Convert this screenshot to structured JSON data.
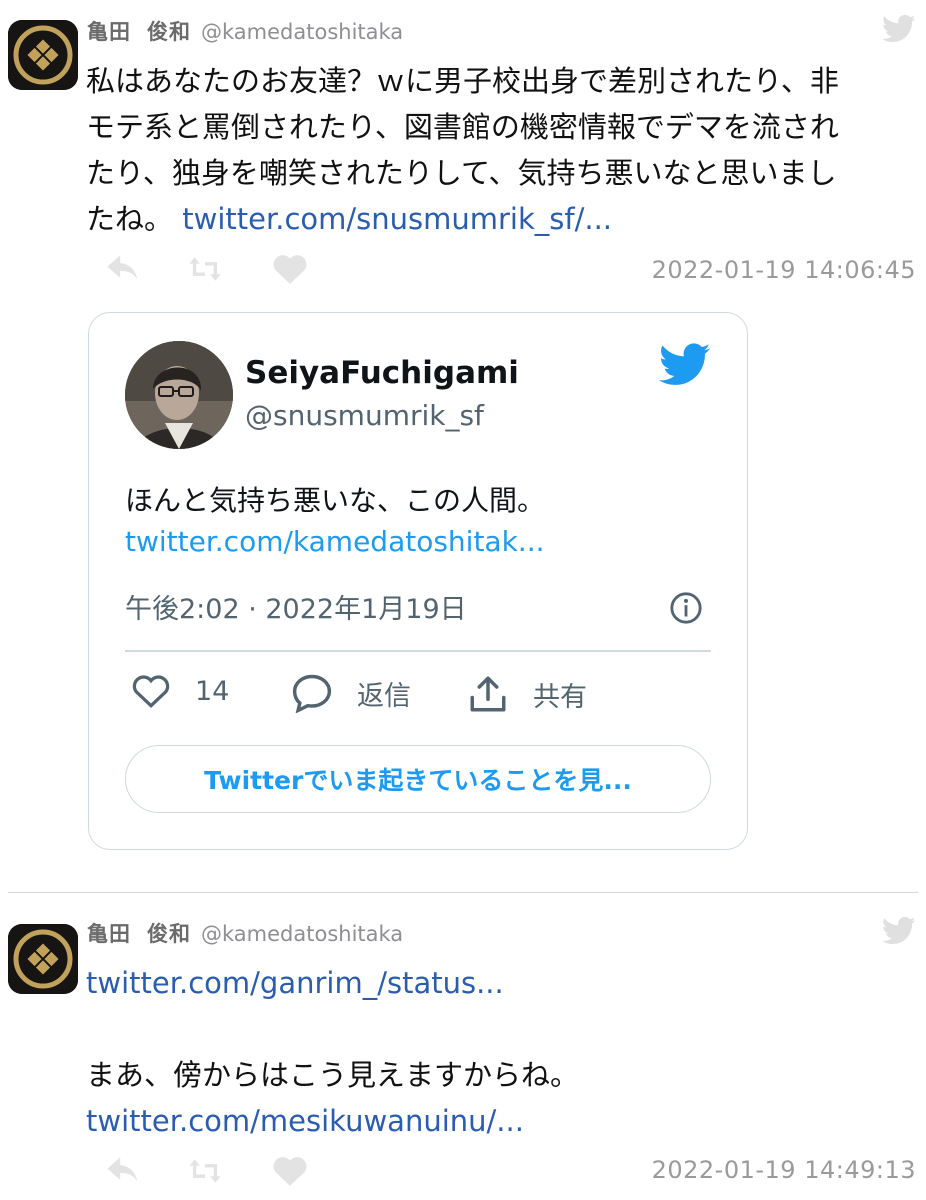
{
  "colors": {
    "link": "#2a5db0",
    "twitter_blue": "#1d9bf0",
    "muted": "#9a9a9a"
  },
  "tweets": [
    {
      "avatar_icon": "family-crest-icon",
      "name_first": "亀田",
      "name_last": "俊和",
      "handle": "@kamedatoshitaka",
      "lines": [
        "私はあなたのお友達？ｗに男子校出身で差別されたり、非",
        "モテ系と罵倒されたり、図書館の機密情報でデマを流され",
        "たり、独身を嘲笑されたりして、気持ち悪いなと思いまし"
      ],
      "last_line_text": "たね。",
      "link": "twitter.com/snusmumrik_sf/...",
      "timestamp": "2022-01-19 14:06:45",
      "embed": {
        "name": "SeiyaFuchigami",
        "handle": "@snusmumrik_sf",
        "text": "ほんと気持ち悪いな、この人間。",
        "link": "twitter.com/kamedatoshitak...",
        "time": "午後2:02 · 2022年1月19日",
        "likes": "14",
        "reply_label": "返信",
        "share_label": "共有",
        "cta": "Twitterでいま起きていることを見..."
      }
    },
    {
      "avatar_icon": "family-crest-icon",
      "name_first": "亀田",
      "name_last": "俊和",
      "handle": "@kamedatoshitaka",
      "link1": "twitter.com/ganrim_/status...",
      "text": "まあ、傍からはこう見えますからね。",
      "link2": "twitter.com/mesikuwanuinu/...",
      "timestamp": "2022-01-19 14:49:13"
    }
  ]
}
